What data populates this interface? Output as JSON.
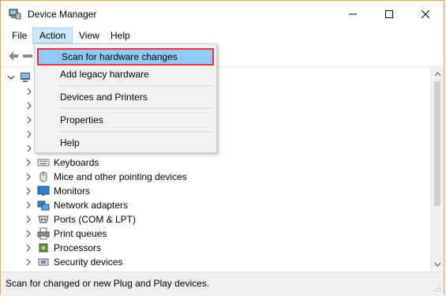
{
  "window": {
    "title": "Device Manager"
  },
  "menubar": {
    "file": "File",
    "action": "Action",
    "view": "View",
    "help": "Help"
  },
  "action_menu": {
    "items": [
      {
        "label": "Scan for hardware changes",
        "selected": true
      },
      {
        "label": "Add legacy hardware"
      },
      {
        "label": "Devices and Printers"
      },
      {
        "label": "Properties"
      },
      {
        "label": "Help"
      }
    ]
  },
  "tree": {
    "items": [
      {
        "label": "Keyboards",
        "icon": "keyboard-icon"
      },
      {
        "label": "Mice and other pointing devices",
        "icon": "mouse-icon"
      },
      {
        "label": "Monitors",
        "icon": "monitor-icon"
      },
      {
        "label": "Network adapters",
        "icon": "network-adapter-icon"
      },
      {
        "label": "Ports (COM & LPT)",
        "icon": "port-icon"
      },
      {
        "label": "Print queues",
        "icon": "printer-icon"
      },
      {
        "label": "Processors",
        "icon": "processor-icon"
      },
      {
        "label": "Security devices",
        "icon": "security-device-icon"
      }
    ]
  },
  "status": {
    "text": "Scan for changed or new Plug and Play devices."
  },
  "colors": {
    "selected_bg": "#91c9f7",
    "selected_border": "#e8303a",
    "menu_active_bg": "#cce8ff"
  }
}
